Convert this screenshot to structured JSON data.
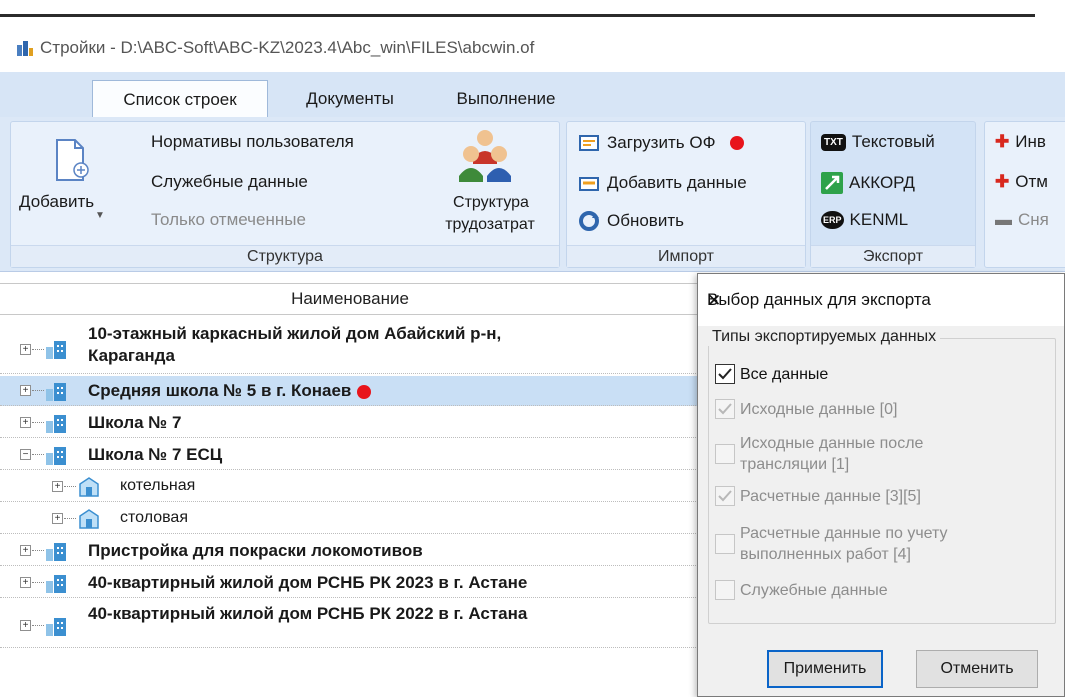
{
  "window": {
    "title": "Стройки - D:\\ABC-Soft\\ABC-KZ\\2023.4\\Abc_win\\FILES\\abcwin.of"
  },
  "tabs": [
    {
      "label": "Список строек",
      "active": true
    },
    {
      "label": "Документы",
      "active": false
    },
    {
      "label": "Выполнение",
      "active": false
    }
  ],
  "ribbon": {
    "structure": {
      "label": "Структура",
      "add_label": "Добавить",
      "items": [
        "Нормативы пользователя",
        "Служебные данные",
        "Только отмеченные"
      ],
      "labor_label_line1": "Структура",
      "labor_label_line2": "трудозатрат"
    },
    "import": {
      "label": "Импорт",
      "items": [
        "Загрузить ОФ",
        "Добавить данные",
        "Обновить"
      ]
    },
    "export": {
      "label": "Экспорт",
      "items": [
        "Текстовый",
        "АККОРД",
        "KENML"
      ],
      "badges": [
        "TXT",
        "ERP"
      ]
    },
    "partial": {
      "items": [
        "Инв",
        "Отм",
        "Сня"
      ]
    }
  },
  "tree": {
    "column_header": "Наименование",
    "rows": [
      {
        "line1": "10-этажный каркасный жилой дом Абайский р-н,",
        "line2": "Караганда"
      },
      {
        "label": "Средняя школа № 5 в г. Конаев",
        "selected": true,
        "marked": true
      },
      {
        "label": "Школа № 7"
      },
      {
        "label": "Школа № 7 ЕСЦ",
        "expanded": true
      },
      {
        "label": "котельная",
        "child": true
      },
      {
        "label": "столовая",
        "child": true
      },
      {
        "label": "Пристройка для покраски локомотивов"
      },
      {
        "label": "40-квартирный жилой дом РСНБ РК 2023 в г. Астане"
      },
      {
        "label": "40-квартирный жилой дом РСНБ РК 2022 в г. Астана"
      }
    ]
  },
  "dialog": {
    "title": "Выбор данных для экспорта",
    "group_label": "Типы экспортируемых данных",
    "options": [
      {
        "line1": "Все данные",
        "checked": true,
        "enabled": true
      },
      {
        "line1": "Исходные данные [0]",
        "checked": true,
        "enabled": false
      },
      {
        "line1": "Исходные данные после",
        "line2": "трансляции [1]",
        "checked": false,
        "enabled": false
      },
      {
        "line1": "Расчетные данные [3][5]",
        "checked": true,
        "enabled": false
      },
      {
        "line1": "Расчетные данные по учету",
        "line2": "выполненных работ [4]",
        "checked": false,
        "enabled": false
      },
      {
        "line1": "Служебные данные",
        "checked": false,
        "enabled": false
      }
    ],
    "apply_label": "Применить",
    "cancel_label": "Отменить"
  },
  "colors": {
    "accent_blue": "#0a64c8",
    "marker_red": "#e8141b",
    "selection": "#c9dff5"
  }
}
